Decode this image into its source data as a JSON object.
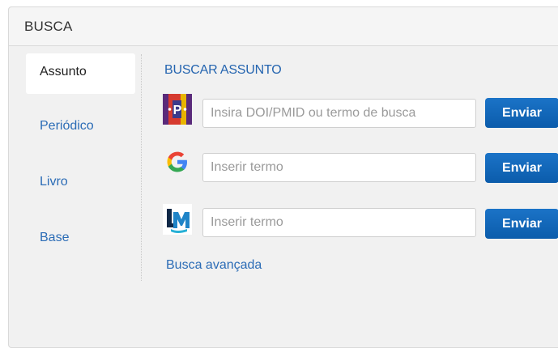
{
  "panel": {
    "title": "BUSCA"
  },
  "tabs": [
    {
      "label": "Assunto",
      "active": true
    },
    {
      "label": "Periódico",
      "active": false
    },
    {
      "label": "Livro",
      "active": false
    },
    {
      "label": "Base",
      "active": false
    }
  ],
  "search": {
    "title": "BUSCAR ASSUNTO",
    "rows": [
      {
        "icon": "pubmed-logo-icon",
        "value": "",
        "placeholder": "Insira DOI/PMID ou termo de busca",
        "button": "Enviar"
      },
      {
        "icon": "google-logo-icon",
        "value": "",
        "placeholder": "Inserir termo",
        "button": "Enviar"
      },
      {
        "icon": "lilacs-logo-icon",
        "value": "",
        "placeholder": "Inserir termo",
        "button": "Enviar"
      }
    ],
    "advanced_link": "Busca avançada"
  },
  "colors": {
    "accent": "#2b6cb6",
    "button": "#0b5cab",
    "panel_bg": "#f1f1f1"
  }
}
